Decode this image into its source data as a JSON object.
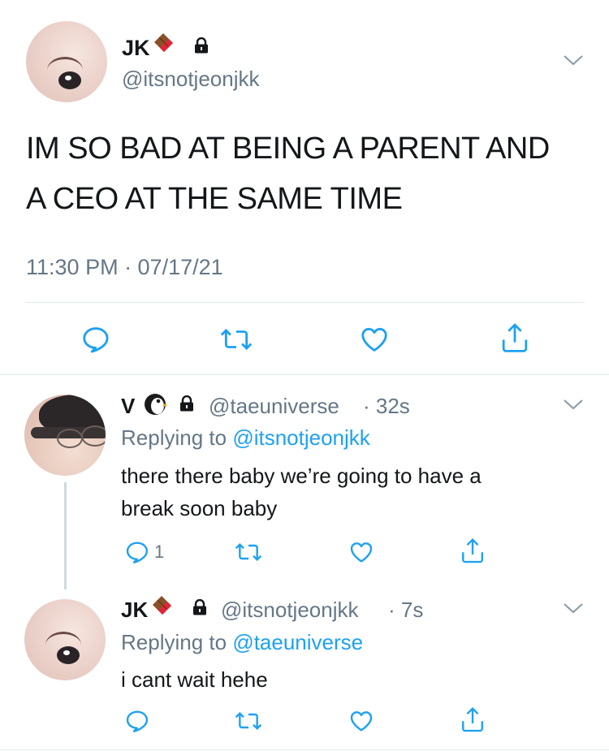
{
  "main_tweet": {
    "display_name": "JK",
    "handle": "@itsnotjeonjkk",
    "text_line1": "IM SO BAD AT BEING A PARENT AND",
    "text_line2": "A CEO AT THE SAME TIME",
    "timestamp": "11:30 PM · 07/17/21"
  },
  "reply1": {
    "display_name": "V",
    "handle": "@taeuniverse",
    "time": "· 32s",
    "replying_prefix": "Replying to",
    "replying_to": "@itsnotjeonjkk",
    "text_line1": "there there baby we’re going to have a",
    "text_line2": "break soon baby",
    "reply_count": "1"
  },
  "reply2": {
    "display_name": "JK",
    "handle": "@itsnotjeonjkk",
    "time": "· 7s",
    "replying_prefix": "Replying to",
    "replying_to": "@taeuniverse",
    "text": "i cant wait hehe"
  },
  "colors": {
    "accent": "#1da1f2",
    "secondary_text": "#657786",
    "divider": "#e1e8ed"
  },
  "icons": [
    "chevron-down-icon",
    "lock-icon",
    "chocolate-emoji",
    "penguin-emoji",
    "reply-icon",
    "retweet-icon",
    "like-icon",
    "share-icon"
  ]
}
